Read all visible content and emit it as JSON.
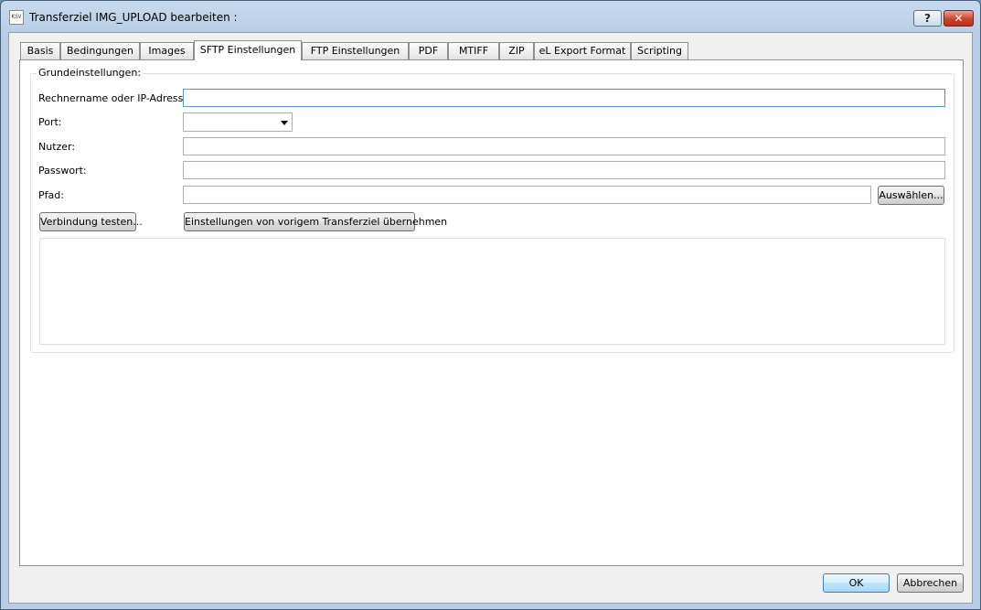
{
  "window": {
    "title": "Transferziel IMG_UPLOAD bearbeiten :",
    "icon_label": "KSV",
    "help_label": "?",
    "close_label": "✕"
  },
  "tabs": [
    {
      "label": "Basis"
    },
    {
      "label": "Bedingungen"
    },
    {
      "label": "Images"
    },
    {
      "label": "SFTP Einstellungen",
      "active": true
    },
    {
      "label": "FTP Einstellungen"
    },
    {
      "label": "PDF"
    },
    {
      "label": "MTIFF"
    },
    {
      "label": "ZIP"
    },
    {
      "label": "eL Export Format"
    },
    {
      "label": "Scripting"
    }
  ],
  "group": {
    "title": "Grundeinstellungen:",
    "host_label": "Rechnername oder IP-Adresse:",
    "host_value": "",
    "port_label": "Port:",
    "port_value": "",
    "user_label": "Nutzer:",
    "user_value": "",
    "password_label": "Passwort:",
    "password_value": "",
    "path_label": "Pfad:",
    "path_value": "",
    "browse_label": "Auswählen...",
    "test_connection_label": "Verbindung testen...",
    "copy_settings_label": "Einstellungen von vorigem Transferziel übernehmen"
  },
  "footer": {
    "ok_label": "OK",
    "cancel_label": "Abbrechen"
  }
}
